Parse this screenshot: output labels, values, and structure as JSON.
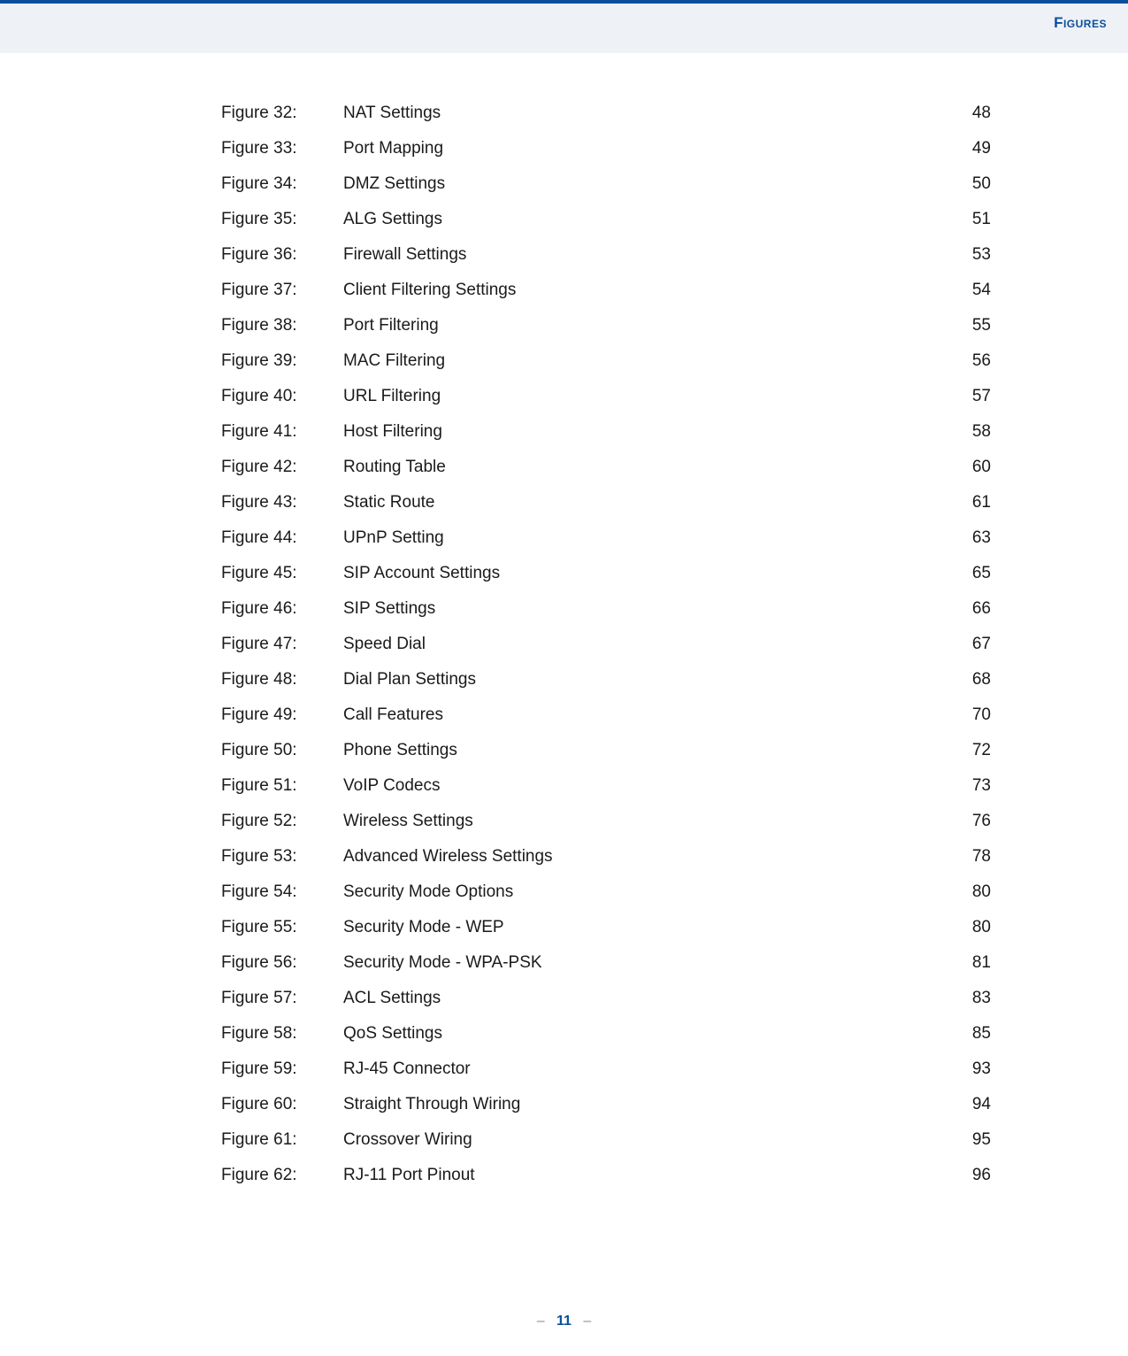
{
  "header": {
    "section_title": "Figures"
  },
  "footer": {
    "prefix": "–",
    "page_number": "11",
    "suffix": "–"
  },
  "figures": [
    {
      "label": "Figure 32:",
      "title": "NAT Settings",
      "page": "48"
    },
    {
      "label": "Figure 33:",
      "title": "Port Mapping",
      "page": "49"
    },
    {
      "label": "Figure 34:",
      "title": "DMZ Settings",
      "page": "50"
    },
    {
      "label": "Figure 35:",
      "title": "ALG Settings",
      "page": "51"
    },
    {
      "label": "Figure 36:",
      "title": "Firewall Settings",
      "page": "53"
    },
    {
      "label": "Figure 37:",
      "title": "Client Filtering Settings",
      "page": "54"
    },
    {
      "label": "Figure 38:",
      "title": "Port Filtering",
      "page": "55"
    },
    {
      "label": "Figure 39:",
      "title": "MAC Filtering",
      "page": "56"
    },
    {
      "label": "Figure 40:",
      "title": "URL Filtering",
      "page": "57"
    },
    {
      "label": "Figure 41:",
      "title": "Host Filtering",
      "page": "58"
    },
    {
      "label": "Figure 42:",
      "title": "Routing Table",
      "page": "60"
    },
    {
      "label": "Figure 43:",
      "title": "Static Route",
      "page": "61"
    },
    {
      "label": "Figure 44:",
      "title": "UPnP Setting",
      "page": "63"
    },
    {
      "label": "Figure 45:",
      "title": "SIP Account Settings",
      "page": "65"
    },
    {
      "label": "Figure 46:",
      "title": "SIP Settings",
      "page": "66"
    },
    {
      "label": "Figure 47:",
      "title": "Speed Dial",
      "page": "67"
    },
    {
      "label": "Figure 48:",
      "title": "Dial Plan Settings",
      "page": "68"
    },
    {
      "label": "Figure 49:",
      "title": "Call Features",
      "page": "70"
    },
    {
      "label": "Figure 50:",
      "title": "Phone Settings",
      "page": "72"
    },
    {
      "label": "Figure 51:",
      "title": "VoIP Codecs",
      "page": "73"
    },
    {
      "label": "Figure 52:",
      "title": "Wireless Settings",
      "page": "76"
    },
    {
      "label": "Figure 53:",
      "title": "Advanced Wireless Settings",
      "page": "78"
    },
    {
      "label": "Figure 54:",
      "title": "Security Mode Options",
      "page": "80"
    },
    {
      "label": "Figure 55:",
      "title": "Security Mode - WEP",
      "page": "80"
    },
    {
      "label": "Figure 56:",
      "title": "Security Mode - WPA-PSK",
      "page": "81"
    },
    {
      "label": "Figure 57:",
      "title": "ACL Settings",
      "page": "83"
    },
    {
      "label": "Figure 58:",
      "title": "QoS Settings",
      "page": "85"
    },
    {
      "label": "Figure 59:",
      "title": "RJ-45 Connector",
      "page": "93"
    },
    {
      "label": "Figure 60:",
      "title": "Straight Through Wiring",
      "page": "94"
    },
    {
      "label": "Figure 61:",
      "title": "Crossover Wiring",
      "page": "95"
    },
    {
      "label": "Figure 62:",
      "title": "RJ-11 Port Pinout",
      "page": "96"
    }
  ]
}
